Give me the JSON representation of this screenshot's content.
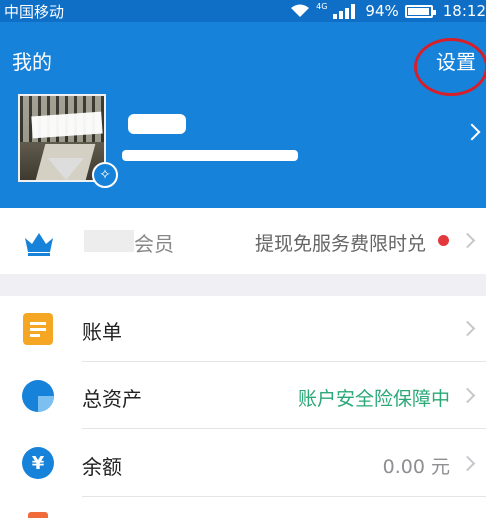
{
  "status_bar": {
    "carrier": "中国移动",
    "network": "4G",
    "battery": "94%",
    "time": "18:12"
  },
  "header": {
    "title": "我的",
    "settings_label": "设置"
  },
  "membership": {
    "label_visible": "会员",
    "promo_text": "提现免服务费限时兑"
  },
  "menu": {
    "bill": {
      "label": "账单"
    },
    "assets": {
      "label": "总资产",
      "value": "账户安全险保障中",
      "value_color": "#2aa876"
    },
    "balance": {
      "label": "余额",
      "value": "0.00 元",
      "value_color": "#8e8e93"
    }
  },
  "colors": {
    "primary": "#1782da",
    "status_bar": "#0f6fc6",
    "annotation": "#d61f2a",
    "badge_dot": "#e4393c",
    "bill_icon": "#f5a623"
  },
  "icons": {
    "crown": "crown-icon",
    "bill": "bill-icon",
    "assets": "pie-chart-icon",
    "balance": "yuan-icon"
  }
}
